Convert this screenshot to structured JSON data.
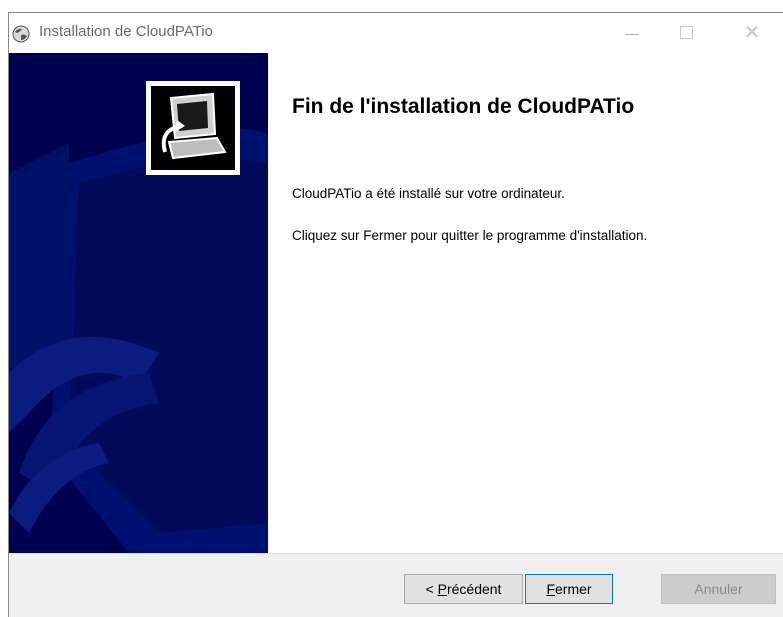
{
  "window": {
    "title": "Installation de CloudPATio",
    "minimize_glyph": "—",
    "close_glyph": "✕"
  },
  "main": {
    "heading": "Fin de l'installation de CloudPATio",
    "paragraph1": "CloudPATio a été installé sur votre ordinateur.",
    "paragraph2": "Cliquez sur Fermer pour quitter le programme d'installation."
  },
  "buttons": {
    "prev_prefix": "< ",
    "prev_accel": "P",
    "prev_rest": "récédent",
    "close_accel": "F",
    "close_rest": "ermer",
    "cancel_label": "Annuler"
  },
  "colors": {
    "sidebar": "#000050",
    "focus_border": "#0078d7"
  },
  "icons": {
    "title": "installer-globe-icon",
    "logo": "computer-install-icon"
  }
}
